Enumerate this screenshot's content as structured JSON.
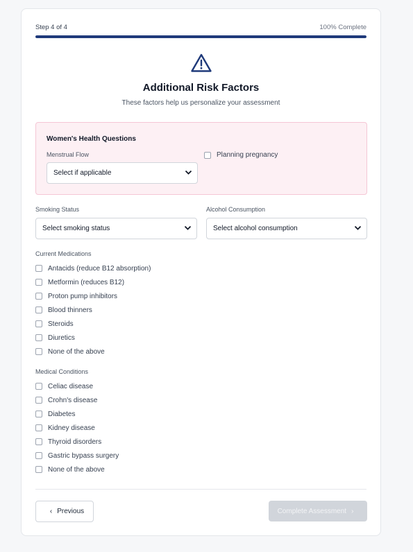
{
  "progress": {
    "step_label": "Step 4 of 4",
    "percent_label": "100% Complete",
    "fraction": 1.0,
    "color": "#1f3a7a"
  },
  "header": {
    "title": "Additional Risk Factors",
    "subtitle": "These factors help us personalize your assessment",
    "icon": "warning-triangle-icon"
  },
  "womens_health": {
    "title": "Women's Health Questions",
    "menstrual_flow_label": "Menstrual Flow",
    "menstrual_flow_value": "Select if applicable",
    "planning_pregnancy_label": "Planning pregnancy",
    "box_color": "#fdf0f4"
  },
  "smoking": {
    "label": "Smoking Status",
    "value": "Select smoking status"
  },
  "alcohol": {
    "label": "Alcohol Consumption",
    "value": "Select alcohol consumption"
  },
  "medications": {
    "label": "Current Medications",
    "items": [
      "Antacids (reduce B12 absorption)",
      "Metformin (reduces B12)",
      "Proton pump inhibitors",
      "Blood thinners",
      "Steroids",
      "Diuretics",
      "None of the above"
    ]
  },
  "conditions": {
    "label": "Medical Conditions",
    "items": [
      "Celiac disease",
      "Crohn's disease",
      "Diabetes",
      "Kidney disease",
      "Thyroid disorders",
      "Gastric bypass surgery",
      "None of the above"
    ]
  },
  "footer": {
    "previous_label": "Previous",
    "complete_label": "Complete Assessment",
    "complete_disabled": true
  }
}
